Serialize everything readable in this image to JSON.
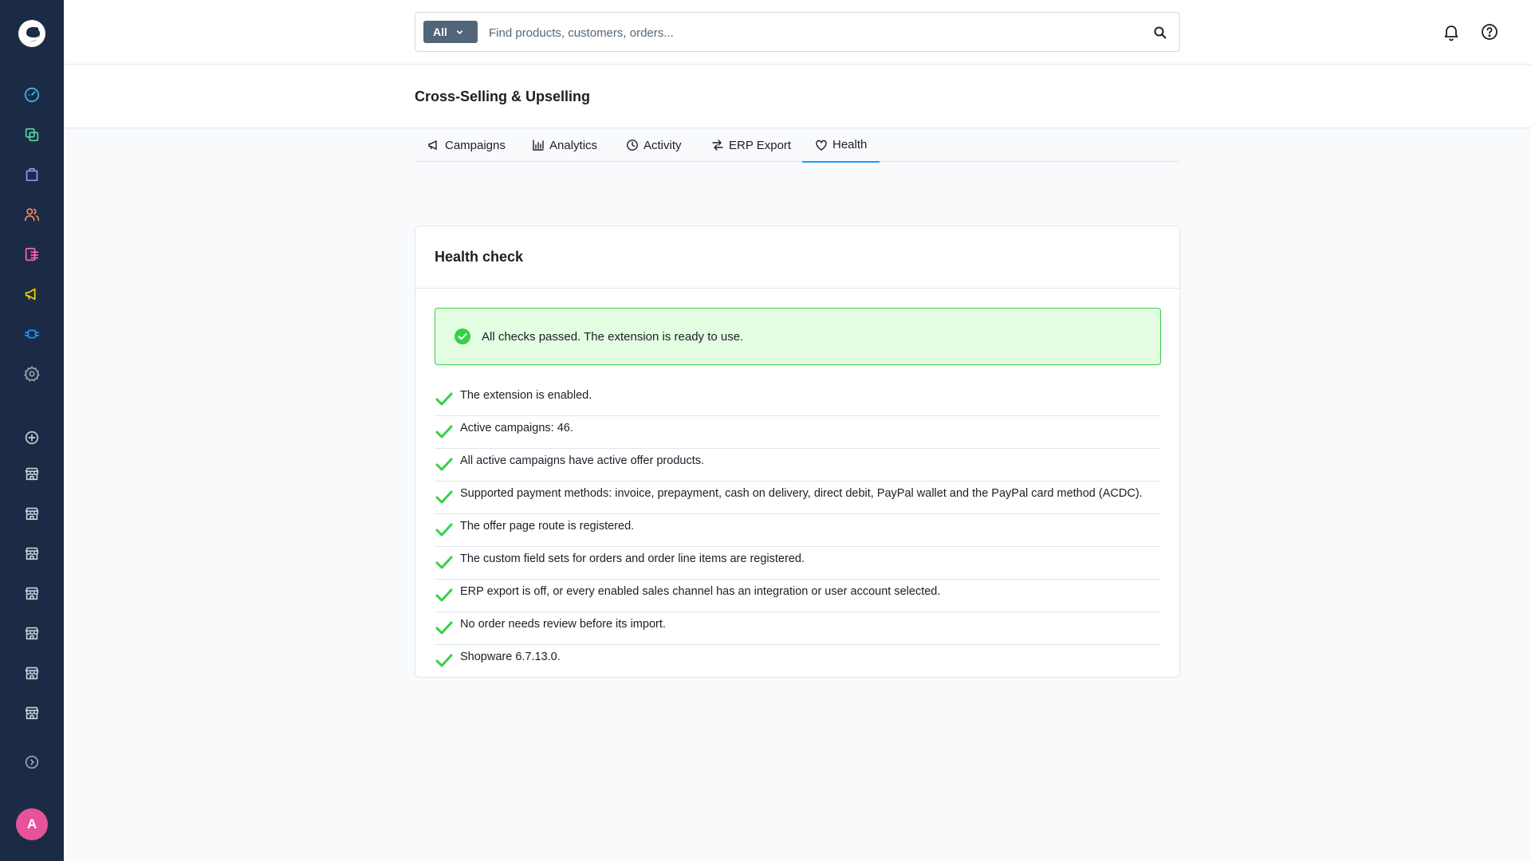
{
  "search": {
    "type_label": "All",
    "placeholder": "Find products, customers, orders..."
  },
  "page": {
    "title": "Cross-Selling & Upselling"
  },
  "tabs": [
    {
      "label": "Campaigns",
      "icon": "megaphone-icon"
    },
    {
      "label": "Analytics",
      "icon": "bar-chart-icon"
    },
    {
      "label": "Activity",
      "icon": "clock-icon"
    },
    {
      "label": "ERP Export",
      "icon": "arrows-exchange-icon"
    },
    {
      "label": "Health",
      "icon": "heart-icon",
      "active": true
    }
  ],
  "health": {
    "title": "Health check",
    "alert": "All checks passed. The extension is ready to use.",
    "checks": [
      "The extension is enabled.",
      "Active campaigns: 46.",
      "All active campaigns have active offer products.",
      "Supported payment methods: invoice, prepayment, cash on delivery, direct debit, PayPal wallet and the PayPal card method (ACDC).",
      "The offer page route is registered.",
      "The custom field sets for orders and order line items are registered.",
      "ERP export is off, or every enabled sales channel has an integration or user account selected.",
      "No order needs review before its import.",
      "Shopware 6.7.13.0."
    ]
  },
  "user": {
    "avatar_initial": "A"
  },
  "colors": {
    "sidebar": "#1c2b45",
    "accent": "#189eff",
    "success": "#37d046",
    "avatar": "#e6539a"
  }
}
